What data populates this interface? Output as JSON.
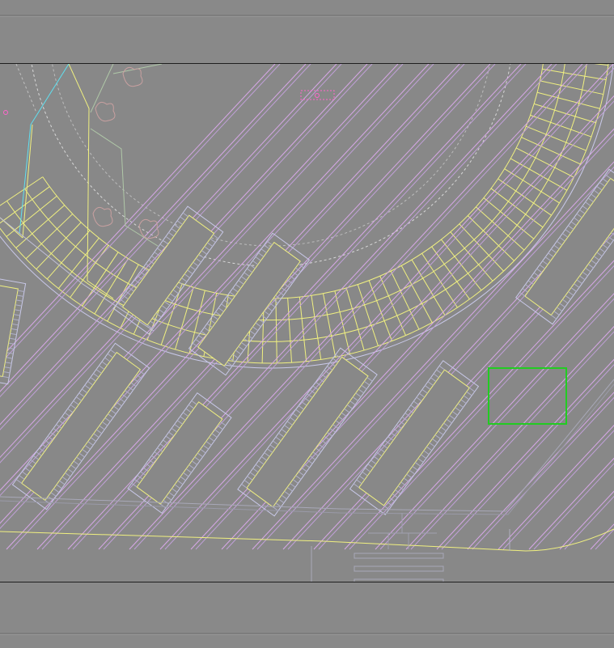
{
  "viewer": {
    "selection_color": "#22cc22",
    "colors": {
      "background": "#888888",
      "outline": "#c8c8e8",
      "curb": "#f0f080",
      "stall": "#d8a8e8",
      "dashed": "#d8d8d8",
      "accent_cyan": "#60e0f0",
      "marker": "#ff66cc",
      "tree": "#c8a0a0"
    },
    "icons": [
      "marker-circle-icon",
      "utility-box-icon"
    ]
  }
}
